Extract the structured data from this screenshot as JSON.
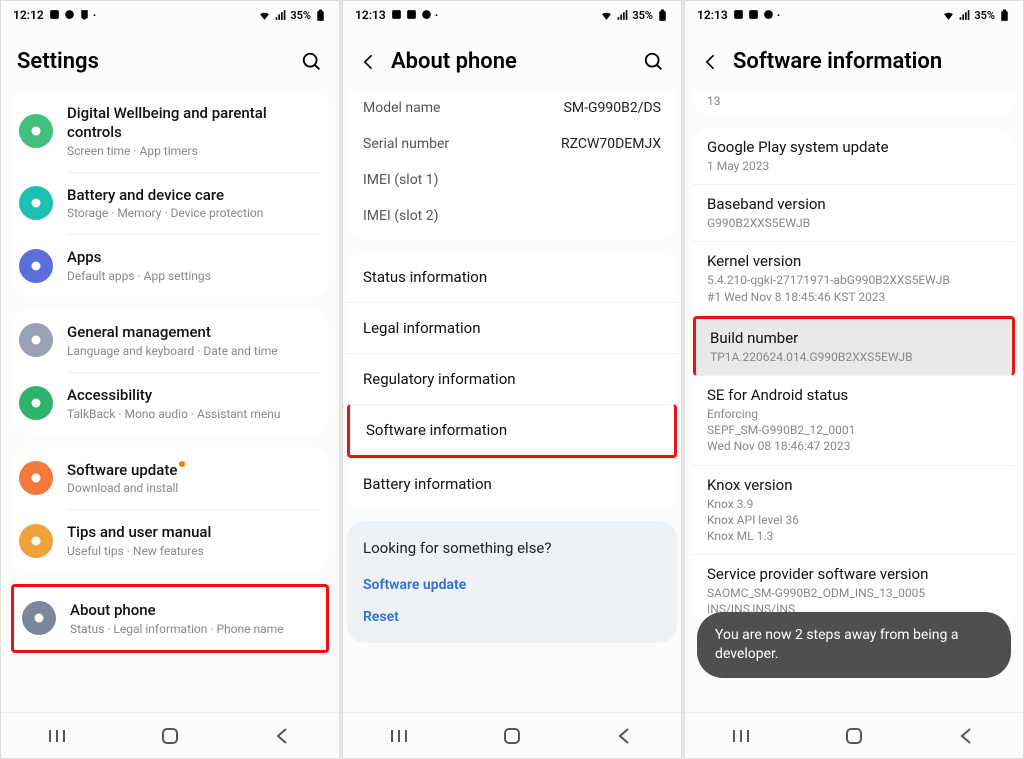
{
  "status": {
    "time1": "12:12",
    "time2": "12:13",
    "time3": "12:13",
    "battery": "35%"
  },
  "screen1": {
    "title": "Settings",
    "items": [
      {
        "title": "Digital Wellbeing and parental controls",
        "sub": "Screen time · App timers",
        "iconColor": "#44c07e"
      },
      {
        "title": "Battery and device care",
        "sub": "Storage · Memory · Device protection",
        "iconColor": "#1fc0b4"
      },
      {
        "title": "Apps",
        "sub": "Default apps · App settings",
        "iconColor": "#5b6edb"
      },
      {
        "title": "General management",
        "sub": "Language and keyboard · Date and time",
        "iconColor": "#9aa0b5"
      },
      {
        "title": "Accessibility",
        "sub": "TalkBack · Mono audio · Assistant menu",
        "iconColor": "#2fb36b"
      },
      {
        "title": "Software update",
        "sub": "Download and install",
        "iconColor": "#f47a3c",
        "badge": true
      },
      {
        "title": "Tips and user manual",
        "sub": "Useful tips · New features",
        "iconColor": "#f0a13a"
      },
      {
        "title": "About phone",
        "sub": "Status · Legal information · Phone name",
        "iconColor": "#7d8799",
        "highlight": true
      }
    ]
  },
  "screen2": {
    "title": "About phone",
    "kv": [
      {
        "k": "Model name",
        "v": "SM-G990B2/DS"
      },
      {
        "k": "Serial number",
        "v": "RZCW70DEMJX"
      },
      {
        "k": "IMEI (slot 1)",
        "v": ""
      },
      {
        "k": "IMEI (slot 2)",
        "v": ""
      }
    ],
    "list": [
      {
        "label": "Status information"
      },
      {
        "label": "Legal information"
      },
      {
        "label": "Regulatory information"
      },
      {
        "label": "Software information",
        "highlight": true
      },
      {
        "label": "Battery information"
      }
    ],
    "looking": {
      "title": "Looking for something else?",
      "links": [
        "Software update",
        "Reset"
      ]
    }
  },
  "screen3": {
    "title": "Software information",
    "partial": "13",
    "items": [
      {
        "title": "Google Play system update",
        "sub": "1 May 2023"
      },
      {
        "title": "Baseband version",
        "sub": "G990B2XXS5EWJB"
      },
      {
        "title": "Kernel version",
        "sub": "5.4.210-qgki-27171971-abG990B2XXS5EWJB\n#1 Wed Nov 8 18:45:46 KST 2023"
      },
      {
        "title": "Build number",
        "sub": "TP1A.220624.014.G990B2XXS5EWJB",
        "highlight": true
      },
      {
        "title": "SE for Android status",
        "sub": "Enforcing\nSEPF_SM-G990B2_12_0001\nWed Nov 08 18:46:47 2023"
      },
      {
        "title": "Knox version",
        "sub": "Knox 3.9\nKnox API level 36\nKnox ML 1.3"
      },
      {
        "title": "Service provider software version",
        "sub": "SAOMC_SM-G990B2_ODM_INS_13_0005\nINS/INS,INS/INS"
      }
    ],
    "toast": "You are now 2 steps away from being a developer."
  }
}
